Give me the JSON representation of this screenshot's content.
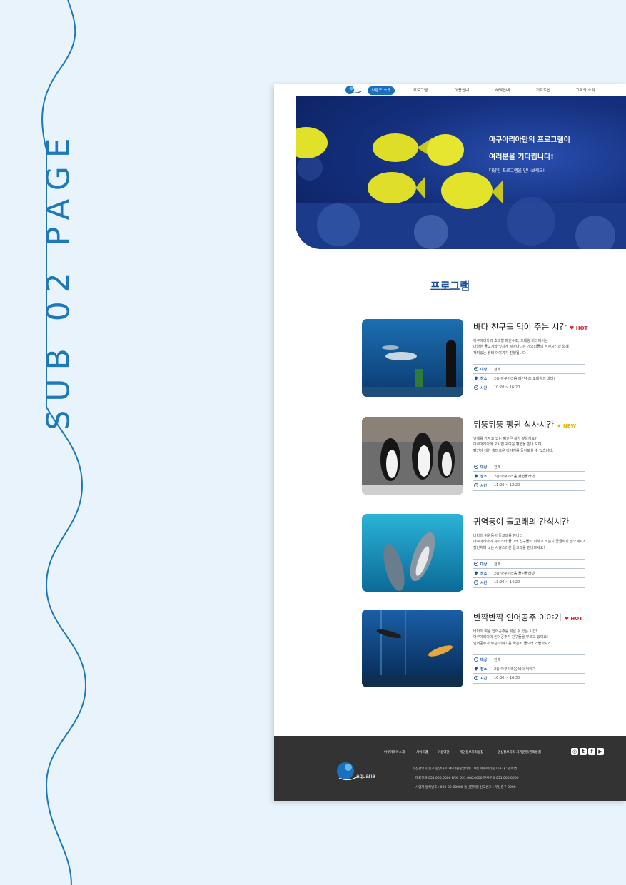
{
  "side_title": "SUB 02 PAGE",
  "colors": {
    "accent": "#1a6fbf",
    "title": "#1a4f9a",
    "hot": "#e0202e",
    "new": "#e8b600",
    "footer_bg": "#333333",
    "wave": "#1e79b8"
  },
  "nav": {
    "items": [
      {
        "label": "브랜드 소개"
      },
      {
        "label": "프로그램"
      },
      {
        "label": "이용안내"
      },
      {
        "label": "혜택안내"
      },
      {
        "label": "기프트샵"
      },
      {
        "label": "고객의 소리"
      }
    ]
  },
  "hero": {
    "line1": "아쿠아리아만의 프로그램이",
    "line2": "여러분을 기다립니다!",
    "sub": "다양한 프로그램을 만나보세요!"
  },
  "section_title": "프로그램",
  "info_labels": {
    "target": "대상",
    "place": "장소",
    "time": "시간"
  },
  "programs": [
    {
      "title": "바다 친구들 먹이 주는 시간",
      "badge": "HOT",
      "badge_type": "hot",
      "desc": [
        "아쿠아리아의 초대형 메인수조, 오대양 바다에서는",
        "다양한 물고기와 멋지게 날아다니는 가오리들의 식사시간과 함께",
        "재미있는 생태 이야기가 진행됩니다"
      ],
      "target": "전체",
      "place": "2층 아쿠아리움 메인수조(오대양의 바다)",
      "time": "10:20 ~ 16:20"
    },
    {
      "title": "뒤뚱뒤뚱 펭귄 식사시간",
      "badge": "NEW",
      "badge_type": "new",
      "desc": [
        "날개를 가지고 있는 펭귄은 새가 맞을까요?",
        "아쿠아리아에 오시면 귀여운 펭귄을 만나 보며",
        "펭귄에 대한 흥미로운 이야기를 들어보실 수 있습니다."
      ],
      "target": "전체",
      "place": "2층 아쿠아리움 펭귄플라넷",
      "time": "11:20 ~ 12:20"
    },
    {
      "title": "귀염둥이 돌고래의 간식시간",
      "badge": "",
      "badge_type": "",
      "desc": [
        "바다의 귀염둥이 돌고래를 만나다",
        "아쿠아리아의 슈퍼스타 돌고래 친구들이 뭐하고 노는지 궁금하지 않으세요?",
        "장난치며 노는 사랑스러운 돌고래를 만나보세요!"
      ],
      "target": "전체",
      "place": "2층 아쿠아리움 돌핀플라넷",
      "time": "13:20 ~ 14:20"
    },
    {
      "title": "반짝반짝 인어공주 이야기",
      "badge": "HOT",
      "badge_type": "hot",
      "desc": [
        "바다의 여왕 인어공주를 맞날 수 있는 시간!",
        "아쿠아리아의 인어공주가 친구들을 부르고 있어요!",
        "인어공주가 무슨 이야기를 하는지 들으러 가볼까요?"
      ],
      "target": "전체",
      "place": "2층 아쿠아리움 바다 이야기",
      "time": "10:30 ~ 16:30"
    }
  ],
  "footer": {
    "links": [
      "아쿠아리아소개",
      "사이트맵",
      "이용약관",
      "개인정보처리방침",
      "영상정보처리 기기운영/관리방침"
    ],
    "address": "부산광역시 중구 중앙대로 26 다원중앙타워 10층 아쿠아리움 대표자 : 김아연",
    "phone": "대표전화 051.000.0000  FAX. 051.000.0000  단체문의 051.000.0000",
    "biz": "사업자 등록번호 : 000-00-00000 통신판매업 신고번호 : 부산중구 0000",
    "logo_text": "aquaria",
    "sns": [
      "instagram-icon",
      "twitter-icon",
      "facebook-icon",
      "youtube-icon"
    ]
  }
}
